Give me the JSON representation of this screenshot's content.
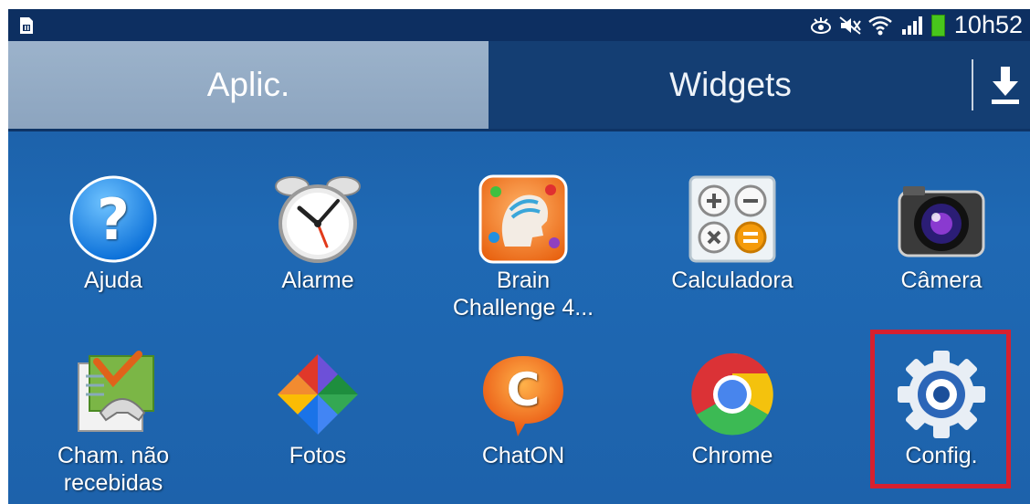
{
  "status_bar": {
    "time": "10h52",
    "icons": [
      "sim-card-icon",
      "eye-icon",
      "mute-icon",
      "wifi-icon",
      "signal-icon",
      "battery-icon"
    ],
    "battery_color": "#48c61c"
  },
  "tabs": [
    {
      "label": "Aplic.",
      "selected": true
    },
    {
      "label": "Widgets",
      "selected": false
    }
  ],
  "download_icon": "download-icon",
  "apps": [
    {
      "label": "Ajuda",
      "icon": "help-icon"
    },
    {
      "label": "Alarme",
      "icon": "alarm-clock-icon"
    },
    {
      "label_line1": "Brain",
      "label_line2": "Challenge 4...",
      "icon": "brain-challenge-icon"
    },
    {
      "label": "Calculadora",
      "icon": "calculator-icon"
    },
    {
      "label": "Câmera",
      "icon": "camera-icon"
    },
    {
      "label_line1": "Cham. não",
      "label_line2": "recebidas",
      "icon": "missed-calls-icon"
    },
    {
      "label": "Fotos",
      "icon": "photos-pinwheel-icon"
    },
    {
      "label": "ChatON",
      "icon": "chaton-icon"
    },
    {
      "label": "Chrome",
      "icon": "chrome-icon"
    },
    {
      "label": "Config.",
      "icon": "settings-gear-icon"
    }
  ],
  "colors": {
    "background": "#1d62ab",
    "status_bar": "#0d2f61",
    "selected_tab": "#9cb3cb",
    "highlight_border": "#d6202f"
  }
}
